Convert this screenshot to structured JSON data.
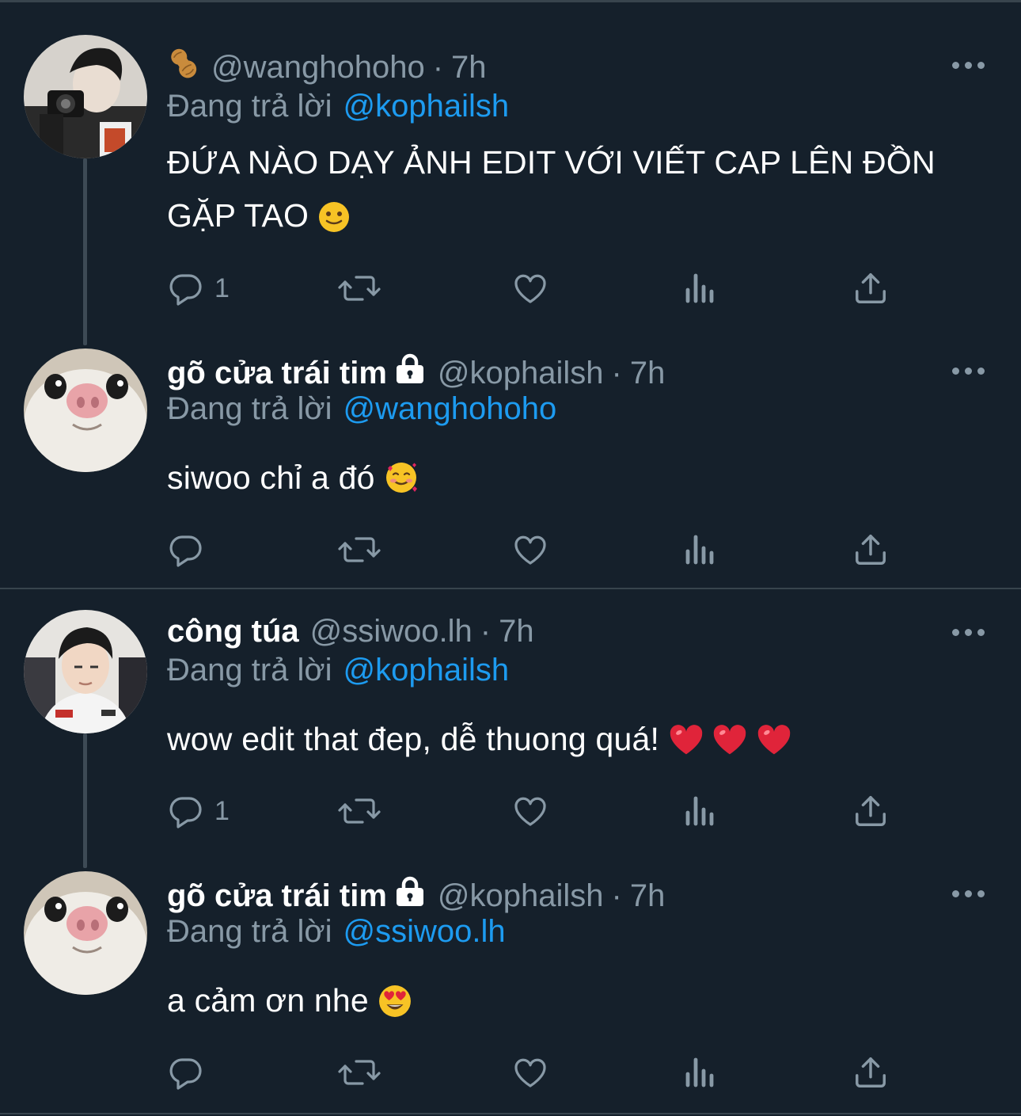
{
  "tweets": [
    {
      "display_name": "",
      "handle": "@wanghohoho",
      "time": "7h",
      "badge_icon": "peanut-icon",
      "replying_label": "Đang trả lời",
      "replying_to": "@kophailsh",
      "text_line1": "ĐỨA NÀO DẠY ẢNH EDIT VỚI VIẾT CAP LÊN ĐỒN",
      "text_line2": "GẶP TAO",
      "trailing_emoji": "slightly-smiling-face",
      "reply_count": "1",
      "avatar": "person-with-camera"
    },
    {
      "display_name": "gõ cửa trái tim",
      "handle": "@kophailsh",
      "time": "7h",
      "locked": true,
      "replying_label": "Đang trả lời",
      "replying_to": "@wanghohoho",
      "text": "siwoo chỉ a đó",
      "trailing_emoji": "smiling-face-with-hearts",
      "reply_count": "",
      "avatar": "white-cat-closeup"
    },
    {
      "display_name": "công túa",
      "handle": "@ssiwoo.lh",
      "time": "7h",
      "replying_label": "Đang trả lời",
      "replying_to": "@kophailsh",
      "text": "wow edit that đep, dễ thuong quá!",
      "trailing_emoji": "red-heart x3",
      "reply_count": "1",
      "avatar": "person-selfie"
    },
    {
      "display_name": "gõ cửa trái tim",
      "handle": "@kophailsh",
      "time": "7h",
      "locked": true,
      "replying_label": "Đang trả lời",
      "replying_to": "@ssiwoo.lh",
      "text": "a cảm ơn nhe",
      "trailing_emoji": "heart-eyes",
      "reply_count": "",
      "avatar": "white-cat-closeup"
    }
  ],
  "colors": {
    "background": "#15202b",
    "secondary_text": "#8899a6",
    "mention": "#1d9bf0",
    "divider": "#38444d"
  }
}
